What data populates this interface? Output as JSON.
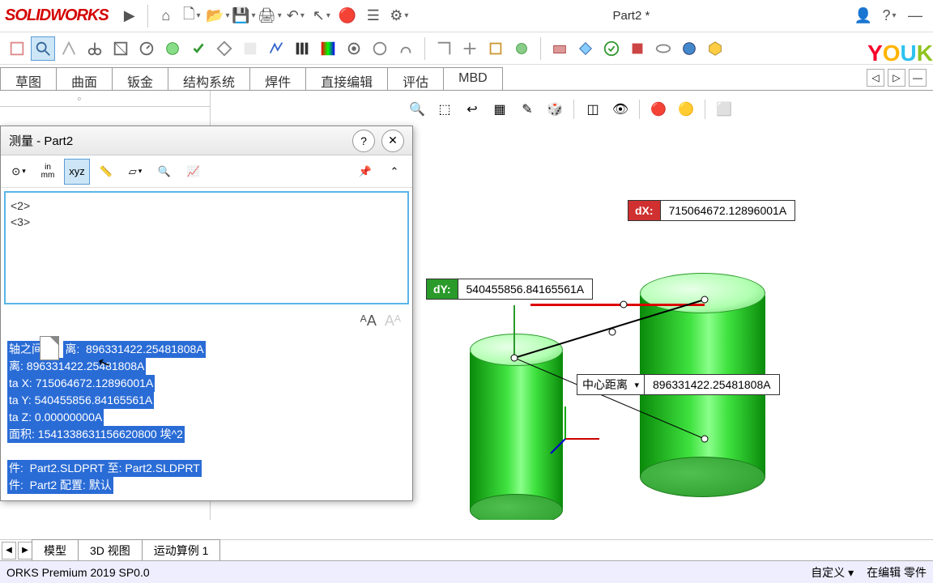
{
  "app": {
    "logo": "SOLIDWORKS",
    "doc_title": "Part2 *"
  },
  "ribbon": {
    "tabs": [
      "草图",
      "曲面",
      "钣金",
      "结构系统",
      "焊件",
      "直接编辑",
      "评估",
      "MBD"
    ],
    "active": "评估"
  },
  "measure_dialog": {
    "title": "测量 - Part2",
    "unit_label": "in\nmm",
    "list_items": [
      "<2>",
      "<3>"
    ],
    "results": {
      "line1_prefix": "轴之间",
      "line1_label": "离:",
      "line1_val": "896331422.25481808A",
      "line2_label": "离:",
      "line2_val": "896331422.25481808A",
      "dx_label": "ta X:",
      "dx_val": "715064672.12896001A",
      "dy_label": "ta Y:",
      "dy_val": "540455856.84165561A",
      "dz_label": "ta Z:",
      "dz_val": "0.00000000A",
      "area_label": "面积:",
      "area_val": "1541338631156620800 埃^2",
      "file_label": "件:",
      "file_val": "Part2.SLDPRT 至:  Part2.SLDPRT",
      "cfg_label": "件:",
      "cfg_val": "Part2 配置:  默认"
    }
  },
  "callouts": {
    "dx": {
      "label": "dX:",
      "value": "715064672.12896001A"
    },
    "dy": {
      "label": "dY:",
      "value": "540455856.84165561A"
    },
    "center": {
      "label": "中心距离",
      "value": "896331422.25481808A"
    }
  },
  "bottom_tabs": [
    "模型",
    "3D 视图",
    "运动算例 1"
  ],
  "status": {
    "left": "ORKS Premium 2019 SP0.0",
    "custom": "自定义 ▾",
    "mode": "在编辑 零件"
  },
  "youku": "YOUK"
}
